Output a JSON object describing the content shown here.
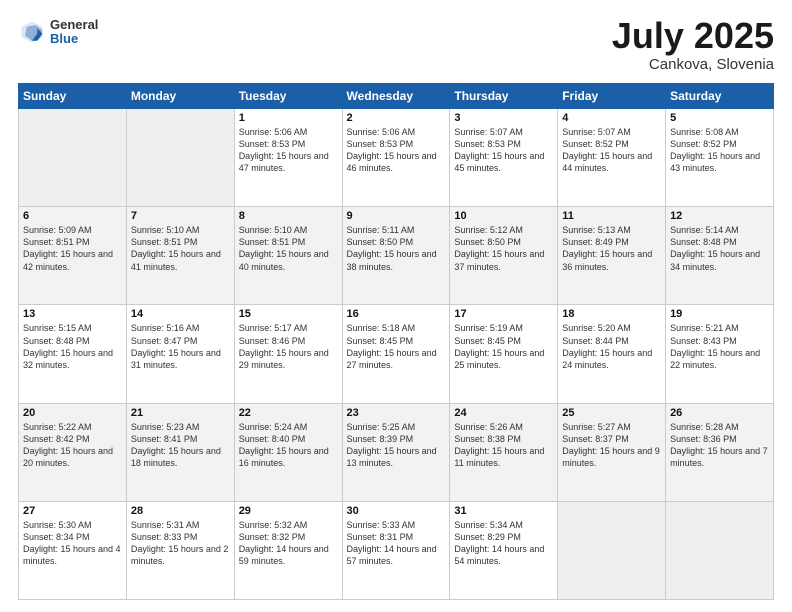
{
  "header": {
    "logo_general": "General",
    "logo_blue": "Blue",
    "month": "July 2025",
    "location": "Cankova, Slovenia"
  },
  "weekdays": [
    "Sunday",
    "Monday",
    "Tuesday",
    "Wednesday",
    "Thursday",
    "Friday",
    "Saturday"
  ],
  "weeks": [
    [
      {
        "day": "",
        "empty": true
      },
      {
        "day": "",
        "empty": true
      },
      {
        "day": "1",
        "sunrise": "Sunrise: 5:06 AM",
        "sunset": "Sunset: 8:53 PM",
        "daylight": "Daylight: 15 hours and 47 minutes."
      },
      {
        "day": "2",
        "sunrise": "Sunrise: 5:06 AM",
        "sunset": "Sunset: 8:53 PM",
        "daylight": "Daylight: 15 hours and 46 minutes."
      },
      {
        "day": "3",
        "sunrise": "Sunrise: 5:07 AM",
        "sunset": "Sunset: 8:53 PM",
        "daylight": "Daylight: 15 hours and 45 minutes."
      },
      {
        "day": "4",
        "sunrise": "Sunrise: 5:07 AM",
        "sunset": "Sunset: 8:52 PM",
        "daylight": "Daylight: 15 hours and 44 minutes."
      },
      {
        "day": "5",
        "sunrise": "Sunrise: 5:08 AM",
        "sunset": "Sunset: 8:52 PM",
        "daylight": "Daylight: 15 hours and 43 minutes."
      }
    ],
    [
      {
        "day": "6",
        "sunrise": "Sunrise: 5:09 AM",
        "sunset": "Sunset: 8:51 PM",
        "daylight": "Daylight: 15 hours and 42 minutes."
      },
      {
        "day": "7",
        "sunrise": "Sunrise: 5:10 AM",
        "sunset": "Sunset: 8:51 PM",
        "daylight": "Daylight: 15 hours and 41 minutes."
      },
      {
        "day": "8",
        "sunrise": "Sunrise: 5:10 AM",
        "sunset": "Sunset: 8:51 PM",
        "daylight": "Daylight: 15 hours and 40 minutes."
      },
      {
        "day": "9",
        "sunrise": "Sunrise: 5:11 AM",
        "sunset": "Sunset: 8:50 PM",
        "daylight": "Daylight: 15 hours and 38 minutes."
      },
      {
        "day": "10",
        "sunrise": "Sunrise: 5:12 AM",
        "sunset": "Sunset: 8:50 PM",
        "daylight": "Daylight: 15 hours and 37 minutes."
      },
      {
        "day": "11",
        "sunrise": "Sunrise: 5:13 AM",
        "sunset": "Sunset: 8:49 PM",
        "daylight": "Daylight: 15 hours and 36 minutes."
      },
      {
        "day": "12",
        "sunrise": "Sunrise: 5:14 AM",
        "sunset": "Sunset: 8:48 PM",
        "daylight": "Daylight: 15 hours and 34 minutes."
      }
    ],
    [
      {
        "day": "13",
        "sunrise": "Sunrise: 5:15 AM",
        "sunset": "Sunset: 8:48 PM",
        "daylight": "Daylight: 15 hours and 32 minutes."
      },
      {
        "day": "14",
        "sunrise": "Sunrise: 5:16 AM",
        "sunset": "Sunset: 8:47 PM",
        "daylight": "Daylight: 15 hours and 31 minutes."
      },
      {
        "day": "15",
        "sunrise": "Sunrise: 5:17 AM",
        "sunset": "Sunset: 8:46 PM",
        "daylight": "Daylight: 15 hours and 29 minutes."
      },
      {
        "day": "16",
        "sunrise": "Sunrise: 5:18 AM",
        "sunset": "Sunset: 8:45 PM",
        "daylight": "Daylight: 15 hours and 27 minutes."
      },
      {
        "day": "17",
        "sunrise": "Sunrise: 5:19 AM",
        "sunset": "Sunset: 8:45 PM",
        "daylight": "Daylight: 15 hours and 25 minutes."
      },
      {
        "day": "18",
        "sunrise": "Sunrise: 5:20 AM",
        "sunset": "Sunset: 8:44 PM",
        "daylight": "Daylight: 15 hours and 24 minutes."
      },
      {
        "day": "19",
        "sunrise": "Sunrise: 5:21 AM",
        "sunset": "Sunset: 8:43 PM",
        "daylight": "Daylight: 15 hours and 22 minutes."
      }
    ],
    [
      {
        "day": "20",
        "sunrise": "Sunrise: 5:22 AM",
        "sunset": "Sunset: 8:42 PM",
        "daylight": "Daylight: 15 hours and 20 minutes."
      },
      {
        "day": "21",
        "sunrise": "Sunrise: 5:23 AM",
        "sunset": "Sunset: 8:41 PM",
        "daylight": "Daylight: 15 hours and 18 minutes."
      },
      {
        "day": "22",
        "sunrise": "Sunrise: 5:24 AM",
        "sunset": "Sunset: 8:40 PM",
        "daylight": "Daylight: 15 hours and 16 minutes."
      },
      {
        "day": "23",
        "sunrise": "Sunrise: 5:25 AM",
        "sunset": "Sunset: 8:39 PM",
        "daylight": "Daylight: 15 hours and 13 minutes."
      },
      {
        "day": "24",
        "sunrise": "Sunrise: 5:26 AM",
        "sunset": "Sunset: 8:38 PM",
        "daylight": "Daylight: 15 hours and 11 minutes."
      },
      {
        "day": "25",
        "sunrise": "Sunrise: 5:27 AM",
        "sunset": "Sunset: 8:37 PM",
        "daylight": "Daylight: 15 hours and 9 minutes."
      },
      {
        "day": "26",
        "sunrise": "Sunrise: 5:28 AM",
        "sunset": "Sunset: 8:36 PM",
        "daylight": "Daylight: 15 hours and 7 minutes."
      }
    ],
    [
      {
        "day": "27",
        "sunrise": "Sunrise: 5:30 AM",
        "sunset": "Sunset: 8:34 PM",
        "daylight": "Daylight: 15 hours and 4 minutes."
      },
      {
        "day": "28",
        "sunrise": "Sunrise: 5:31 AM",
        "sunset": "Sunset: 8:33 PM",
        "daylight": "Daylight: 15 hours and 2 minutes."
      },
      {
        "day": "29",
        "sunrise": "Sunrise: 5:32 AM",
        "sunset": "Sunset: 8:32 PM",
        "daylight": "Daylight: 14 hours and 59 minutes."
      },
      {
        "day": "30",
        "sunrise": "Sunrise: 5:33 AM",
        "sunset": "Sunset: 8:31 PM",
        "daylight": "Daylight: 14 hours and 57 minutes."
      },
      {
        "day": "31",
        "sunrise": "Sunrise: 5:34 AM",
        "sunset": "Sunset: 8:29 PM",
        "daylight": "Daylight: 14 hours and 54 minutes."
      },
      {
        "day": "",
        "empty": true
      },
      {
        "day": "",
        "empty": true
      }
    ]
  ]
}
